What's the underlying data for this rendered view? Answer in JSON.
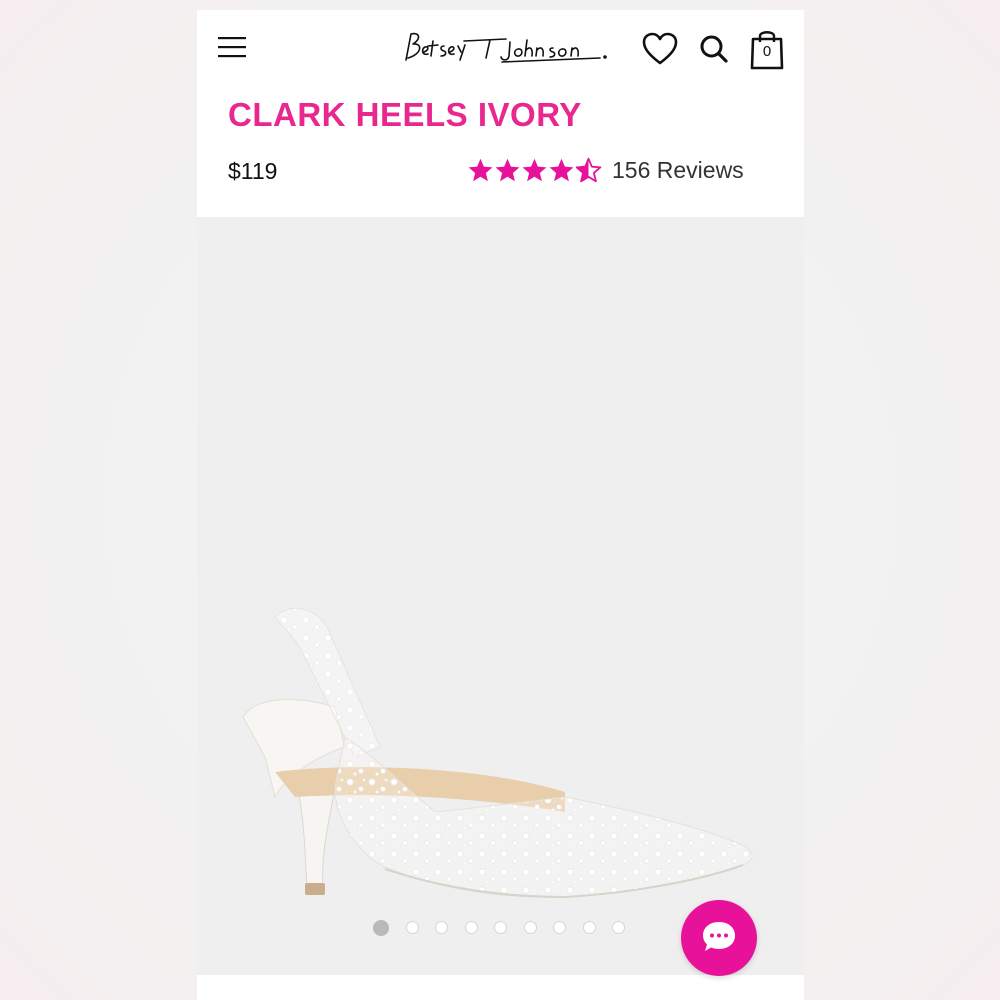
{
  "brand": {
    "logo_text": "Betsey Johnson"
  },
  "header": {
    "menu_icon": "hamburger-menu-icon",
    "wishlist_icon": "heart-icon",
    "search_icon": "search-icon",
    "bag_icon": "shopping-bag-icon",
    "bag_count": "0"
  },
  "product": {
    "title": "CLARK HEELS IVORY",
    "price": "$119",
    "rating": 4.5,
    "reviews_label": "156 Reviews"
  },
  "gallery": {
    "image_count": 9,
    "active_index": 0
  },
  "chat": {
    "icon": "chat-bubble-icon"
  },
  "colors": {
    "accent_pink": "#e8288f",
    "chat_pink": "#e8129a",
    "gallery_bg": "#efefef"
  }
}
